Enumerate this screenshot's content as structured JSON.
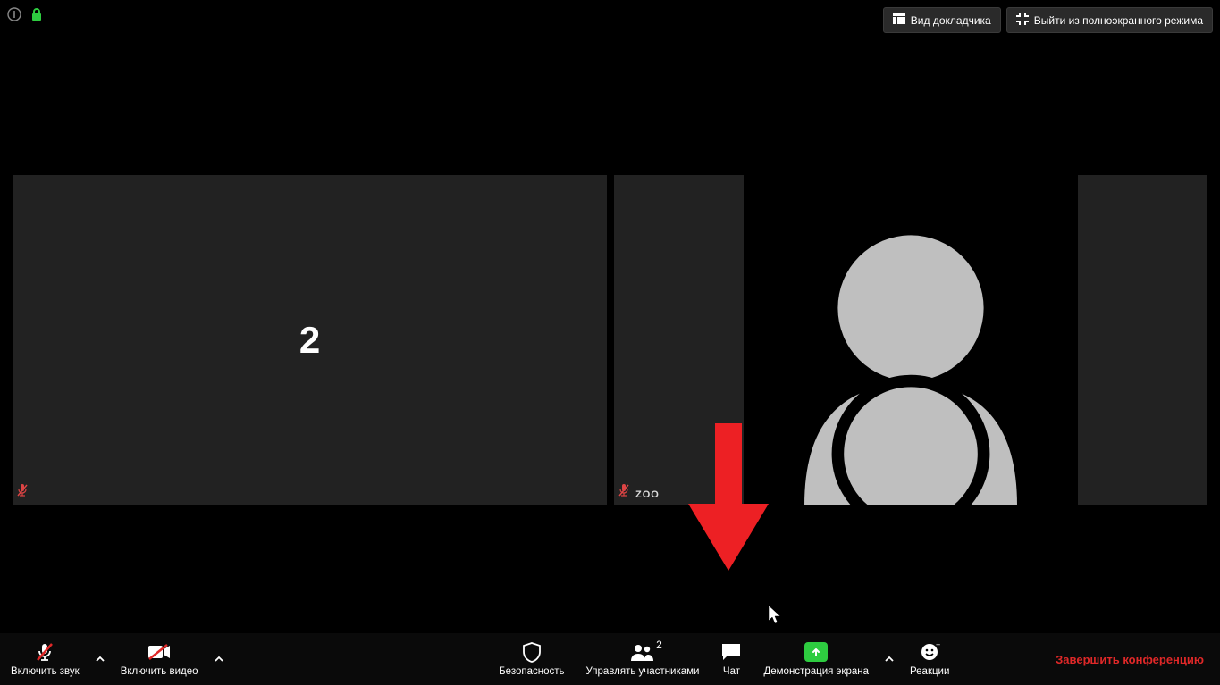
{
  "top": {
    "speaker_view_label": "Вид докладчика",
    "exit_fullscreen_label": "Выйти из полноэкранного режима"
  },
  "gallery": {
    "tile1_number": "2",
    "tile2_name": "ZOO"
  },
  "toolbar": {
    "unmute_label": "Включить звук",
    "start_video_label": "Включить видео",
    "security_label": "Безопасность",
    "participants_label": "Управлять участниками",
    "participants_count": "2",
    "chat_label": "Чат",
    "share_label": "Демонстрация экрана",
    "reactions_label": "Реакции",
    "end_label": "Завершить конференцию"
  },
  "colors": {
    "accent_green": "#2ecc40",
    "danger_red": "#e02828",
    "arrow_red": "#ed2024",
    "lock_green": "#2ecc40"
  }
}
